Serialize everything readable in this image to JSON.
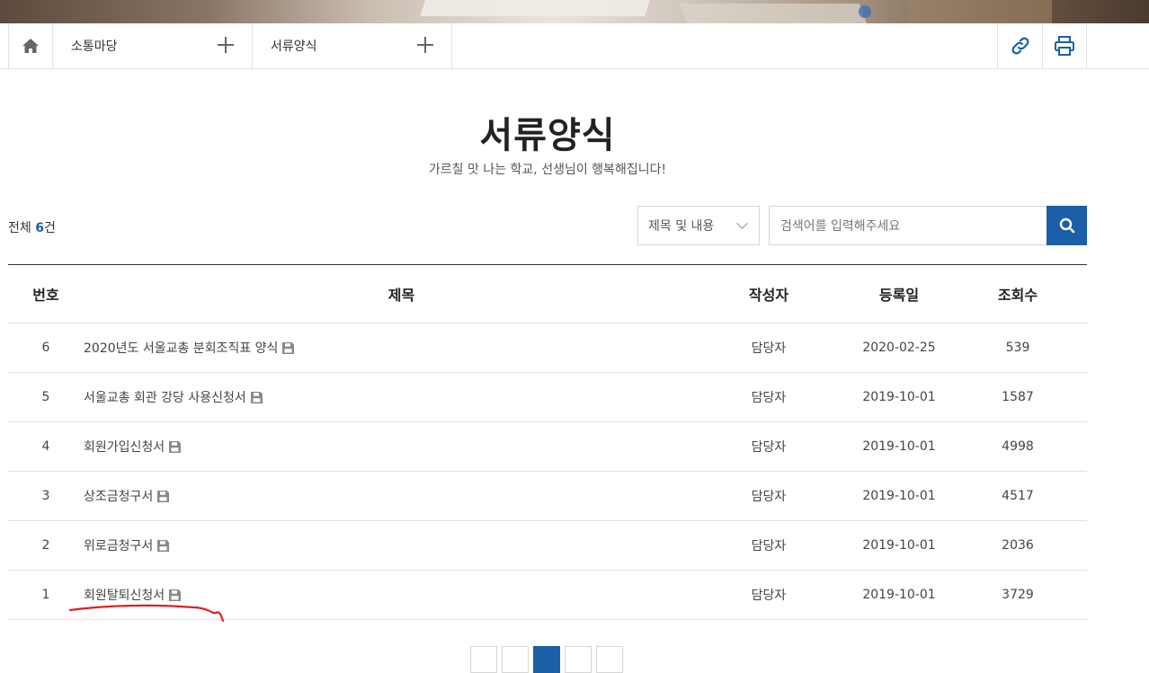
{
  "nav": {
    "home_icon": "home-icon",
    "menu1": "소통마당",
    "menu2": "서류양식",
    "link_icon": "link-icon",
    "print_icon": "print-icon"
  },
  "page": {
    "title": "서류양식",
    "subtitle": "가르칠 맛 나는 학교, 선생님이 행복해집니다!"
  },
  "summary": {
    "prefix": "전체 ",
    "count": "6",
    "suffix": "건"
  },
  "search": {
    "select_value": "제목 및 내용",
    "placeholder": "검색어를 입력해주세요",
    "button_icon": "search-icon"
  },
  "table": {
    "headers": {
      "num": "번호",
      "title": "제목",
      "author": "작성자",
      "date": "등록일",
      "views": "조회수"
    },
    "rows": [
      {
        "num": "6",
        "title": "2020년도 서울교총 분회조직표 양식",
        "author": "담당자",
        "date": "2020-02-25",
        "views": "539"
      },
      {
        "num": "5",
        "title": "서울교총 회관 강당 사용신청서",
        "author": "담당자",
        "date": "2019-10-01",
        "views": "1587"
      },
      {
        "num": "4",
        "title": "회원가입신청서",
        "author": "담당자",
        "date": "2019-10-01",
        "views": "4998"
      },
      {
        "num": "3",
        "title": "상조금청구서",
        "author": "담당자",
        "date": "2019-10-01",
        "views": "4517"
      },
      {
        "num": "2",
        "title": "위로금청구서",
        "author": "담당자",
        "date": "2019-10-01",
        "views": "2036"
      },
      {
        "num": "1",
        "title": "회원탈퇴신청서",
        "author": "담당자",
        "date": "2019-10-01",
        "views": "3729"
      }
    ]
  },
  "colors": {
    "accent": "#1a5fa8",
    "annotation": "#e02020"
  }
}
